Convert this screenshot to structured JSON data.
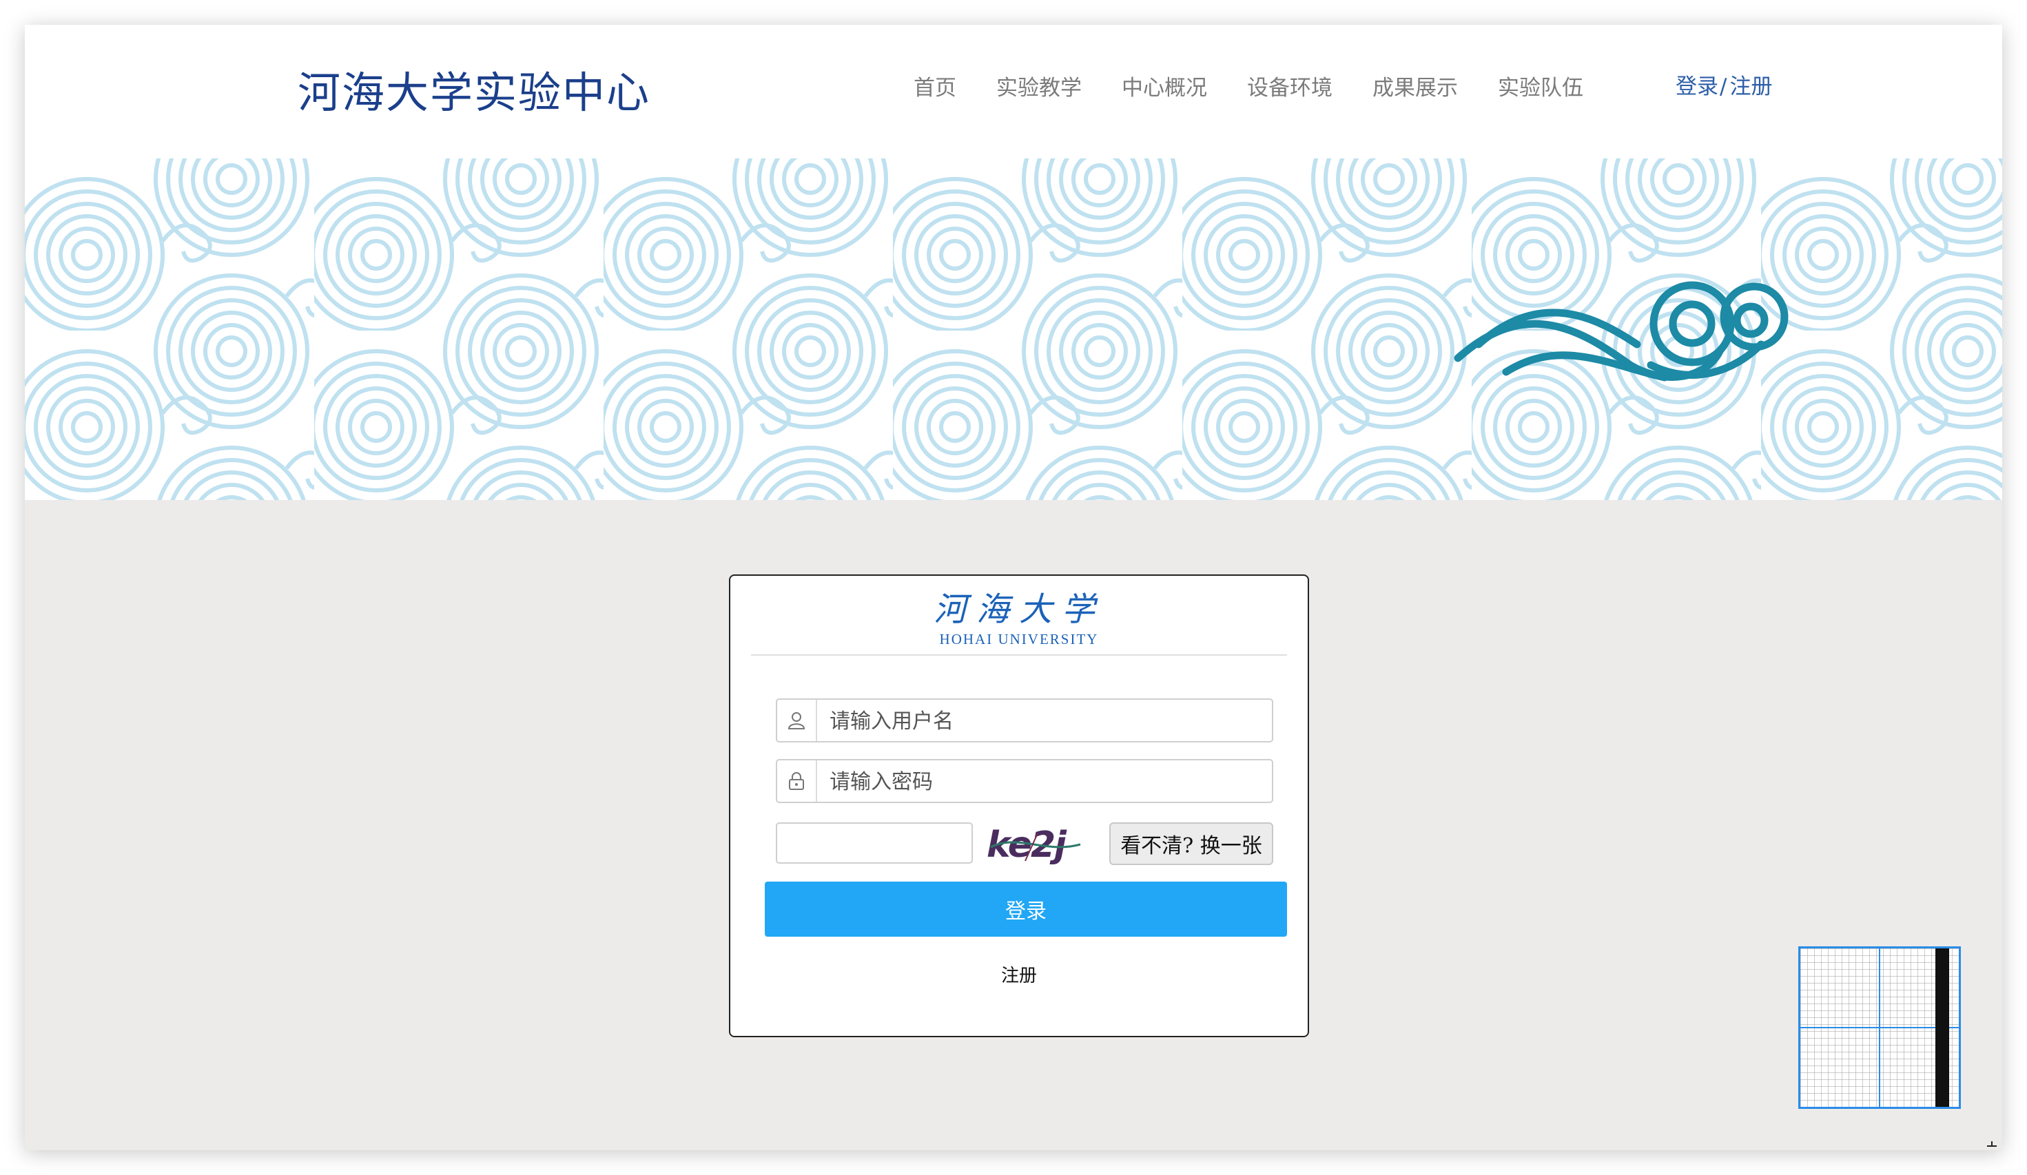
{
  "header": {
    "site_title": "河海大学实验中心",
    "nav": [
      {
        "label": "首页"
      },
      {
        "label": "实验教学"
      },
      {
        "label": "中心概况"
      },
      {
        "label": "设备环境"
      },
      {
        "label": "成果展示"
      },
      {
        "label": "实验队伍"
      }
    ],
    "login_label": "登录",
    "separator": "/",
    "register_label": "注册"
  },
  "login": {
    "logo_cn": "河海大学",
    "logo_en": "HOHAI UNIVERSITY",
    "username_placeholder": "请输入用户名",
    "password_placeholder": "请输入密码",
    "captcha_value": "",
    "captcha_text": "ke2j",
    "refresh_label": "看不清? 换一张",
    "submit_label": "登录",
    "register_label": "注册"
  },
  "colors": {
    "brand_blue": "#1b3f8b",
    "button_blue": "#21a7f5",
    "wave_blue": "#bfe1f0",
    "cloud_teal": "#1d8aa6",
    "page_bg": "#ecebe9"
  },
  "icons": {
    "username": "user-icon",
    "password": "lock-icon"
  }
}
